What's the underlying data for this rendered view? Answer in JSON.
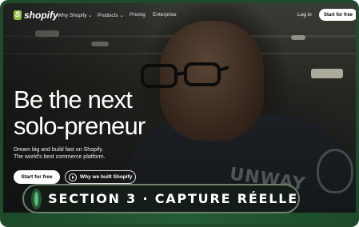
{
  "nav": {
    "logo_text": "shopify",
    "items": [
      {
        "label": "Why Shopify ⌄"
      },
      {
        "label": "Products ⌄"
      },
      {
        "label": "Pricing"
      },
      {
        "label": "Enterprise"
      }
    ],
    "login_label": "Log in",
    "start_label": "Start for free"
  },
  "hero": {
    "headline_line1": "Be the next",
    "headline_line2": "solo-preneur",
    "sub_line1": "Dream big and build fast on Shopify.",
    "sub_line2": "The world's best commerce platform.",
    "start_label": "Start for free",
    "why_label": "Why we built Shopify",
    "hoodie_text": "UNWAY"
  },
  "badge": {
    "text": "SECTION 3 · CAPTURE RÉELLE",
    "dot_color": "#52c174"
  },
  "colors": {
    "brand": "#95bf47",
    "frame": "#1f4a2c"
  }
}
